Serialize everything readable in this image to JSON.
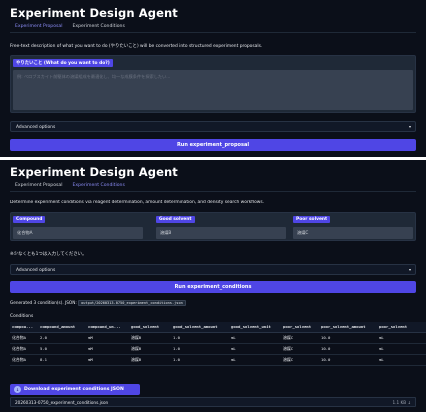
{
  "top": {
    "title": "Experiment Design Agent",
    "tabs": [
      {
        "label": "Experiment Proposal",
        "active": true
      },
      {
        "label": "Experiment Conditions",
        "active": false
      }
    ],
    "description": "Free-text description of what you want to do (やりたいこと) will be converted into structured experiment proposals.",
    "input_label": "やりたいこと (What do you want to do?)",
    "input_placeholder": "例: ペロブスカイト前駆体の溶媒組成を最適化し、均一な成膜条件を探索したい...",
    "advanced_label": "Advanced options",
    "run_label": "Run experiment_proposal"
  },
  "bottom": {
    "title": "Experiment Design Agent",
    "tabs": [
      {
        "label": "Experiment Proposal",
        "active": false
      },
      {
        "label": "Experiment Conditions",
        "active": true
      }
    ],
    "description": "Determine experiment conditions via reagent determination, amount determination, and density search workflows.",
    "fields": [
      {
        "label": "Compound",
        "value": "化合物A"
      },
      {
        "label": "Good solvent",
        "value": "溶媒B"
      },
      {
        "label": "Poor solvent",
        "value": "溶媒C"
      }
    ],
    "note": "※少なくとも1つは入力してください。",
    "advanced_label": "Advanced options",
    "run_label": "Run experiment_conditions",
    "generated_prefix": "Generated 3 condition(s). JSON:",
    "generated_path": "output/20260313-0750_experiment_conditions.json",
    "conditions_label": "Conditions",
    "table": {
      "headers": [
        "compou...",
        "compound_amount",
        "compound_un...",
        "good_solvent",
        "good_solvent_amount",
        "good_solvent_unit",
        "poor_solvent",
        "poor_solvent_amount",
        "poor_solvent"
      ],
      "rows": [
        [
          "化合物A",
          "2.0",
          "mM",
          "溶媒B",
          "1.0",
          "mL",
          "溶媒C",
          "10.0",
          "mL"
        ],
        [
          "化合物A",
          "5.0",
          "mM",
          "溶媒B",
          "1.0",
          "mL",
          "溶媒C",
          "10.0",
          "mL"
        ],
        [
          "化合物A",
          "8.1",
          "mM",
          "溶媒B",
          "1.0",
          "mL",
          "溶媒C",
          "10.0",
          "mL"
        ]
      ]
    },
    "download_label": "Download experiment conditions JSON",
    "file_name": "20260313-0750_experiment_conditions.json",
    "file_size": "1.1 KB ↓"
  },
  "colors": {
    "accent": "#4f46e5",
    "background": "#0b0f19",
    "surface": "#1f2937"
  },
  "icons": {
    "download": "download-icon",
    "caret": "caret-down-icon"
  }
}
